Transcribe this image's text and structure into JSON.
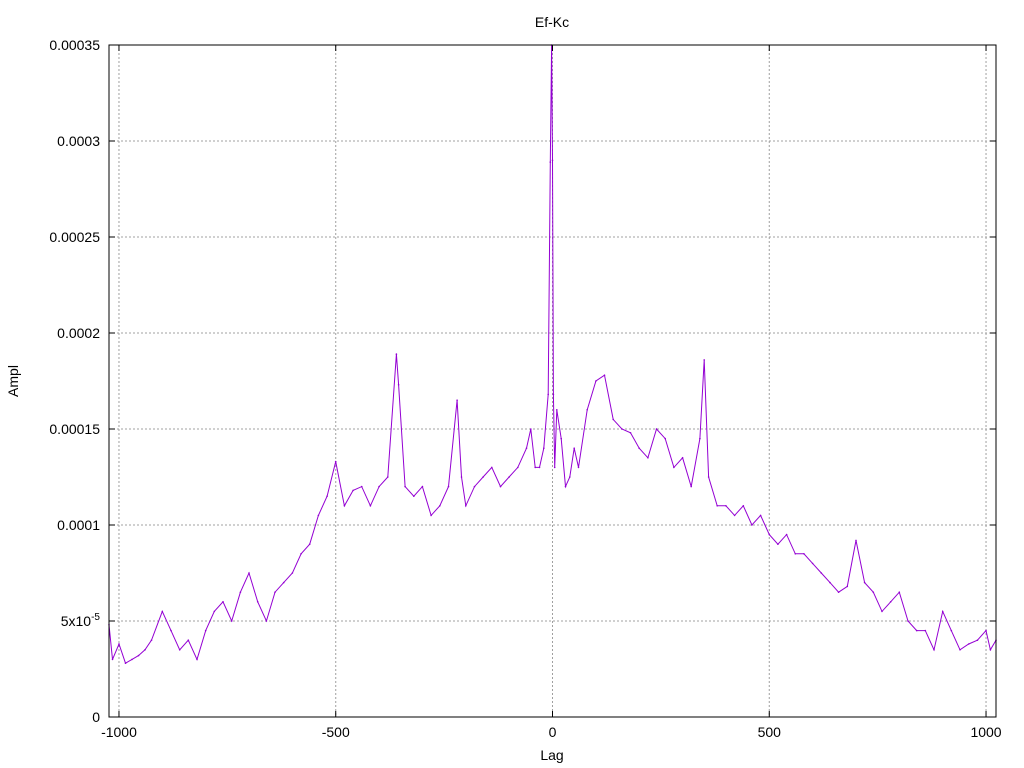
{
  "chart_data": {
    "type": "line",
    "title": "Ef-Kc",
    "xlabel": "Lag",
    "ylabel": "Ampl",
    "xlim": [
      -1023,
      1023
    ],
    "ylim": [
      0,
      0.00035
    ],
    "x_ticks": [
      -1000,
      -500,
      0,
      500,
      1000
    ],
    "x_tick_labels": [
      "-1000",
      "-500",
      "0",
      "500",
      "1000"
    ],
    "y_ticks": [
      0,
      5e-05,
      0.0001,
      0.00015,
      0.0002,
      0.00025,
      0.0003,
      0.00035
    ],
    "y_tick_labels": [
      "0",
      "5x10",
      "0.0001",
      "0.00015",
      "0.0002",
      "0.00025",
      "0.0003",
      "0.00035"
    ],
    "y_tick_exponent": "-5",
    "grid": true,
    "series": [
      {
        "color": "#9400d3",
        "x": [
          -1023,
          -1015,
          -1000,
          -985,
          -970,
          -955,
          -940,
          -925,
          -900,
          -880,
          -860,
          -840,
          -820,
          -800,
          -780,
          -760,
          -740,
          -720,
          -700,
          -680,
          -660,
          -640,
          -620,
          -600,
          -580,
          -560,
          -540,
          -520,
          -500,
          -480,
          -460,
          -440,
          -420,
          -400,
          -380,
          -360,
          -355,
          -340,
          -320,
          -300,
          -280,
          -260,
          -240,
          -220,
          -210,
          -200,
          -180,
          -160,
          -140,
          -120,
          -100,
          -80,
          -60,
          -50,
          -40,
          -30,
          -20,
          -10,
          -5,
          -2,
          0,
          2,
          5,
          10,
          20,
          30,
          40,
          50,
          60,
          80,
          100,
          120,
          140,
          160,
          180,
          200,
          220,
          240,
          260,
          280,
          300,
          320,
          340,
          350,
          360,
          380,
          400,
          420,
          440,
          460,
          480,
          500,
          520,
          540,
          560,
          580,
          600,
          620,
          640,
          660,
          680,
          700,
          720,
          740,
          760,
          780,
          800,
          820,
          840,
          860,
          880,
          900,
          920,
          940,
          960,
          980,
          1000,
          1010,
          1023
        ],
        "y": [
          4.8e-05,
          3e-05,
          3.8e-05,
          2.8e-05,
          3e-05,
          3.2e-05,
          3.5e-05,
          4e-05,
          5.5e-05,
          4.5e-05,
          3.5e-05,
          4e-05,
          3e-05,
          4.5e-05,
          5.5e-05,
          6e-05,
          5e-05,
          6.5e-05,
          7.5e-05,
          6e-05,
          5e-05,
          6.5e-05,
          7e-05,
          7.5e-05,
          8.5e-05,
          9e-05,
          0.000105,
          0.000115,
          0.000133,
          0.00011,
          0.000118,
          0.00012,
          0.00011,
          0.00012,
          0.000125,
          0.000189,
          0.000173,
          0.00012,
          0.000115,
          0.00012,
          0.000105,
          0.00011,
          0.00012,
          0.000165,
          0.000125,
          0.00011,
          0.00012,
          0.000125,
          0.00013,
          0.00012,
          0.000125,
          0.00013,
          0.00014,
          0.00015,
          0.00013,
          0.00013,
          0.00014,
          0.000168,
          0.000289,
          0.00035,
          0.00029,
          0.000168,
          0.00013,
          0.00016,
          0.000145,
          0.00012,
          0.000125,
          0.00014,
          0.00013,
          0.00016,
          0.000175,
          0.000178,
          0.000155,
          0.00015,
          0.000148,
          0.00014,
          0.000135,
          0.00015,
          0.000145,
          0.00013,
          0.000135,
          0.00012,
          0.000145,
          0.000186,
          0.000125,
          0.00011,
          0.00011,
          0.000105,
          0.00011,
          0.0001,
          0.000105,
          9.5e-05,
          9e-05,
          9.5e-05,
          8.5e-05,
          8.5e-05,
          8e-05,
          7.5e-05,
          7e-05,
          6.5e-05,
          6.8e-05,
          9.2e-05,
          7e-05,
          6.5e-05,
          5.5e-05,
          6e-05,
          6.5e-05,
          5e-05,
          4.5e-05,
          4.5e-05,
          3.5e-05,
          5.5e-05,
          4.5e-05,
          3.5e-05,
          3.8e-05,
          4e-05,
          4.5e-05,
          3.5e-05,
          4e-05
        ]
      }
    ]
  }
}
